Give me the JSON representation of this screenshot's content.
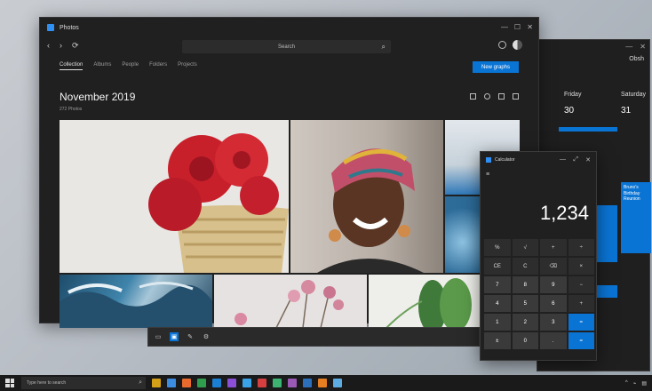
{
  "calendar": {
    "month": "Obsh",
    "days": [
      "Friday",
      "Saturday"
    ],
    "dates": [
      "30",
      "31"
    ],
    "event": "Bruno's Birthday Reunion"
  },
  "photos": {
    "title": "Photos",
    "search_placeholder": "Search",
    "tabs": [
      "Collection",
      "Albums",
      "People",
      "Folders",
      "Projects"
    ],
    "import_label": "New graphs",
    "heading": "November 2019",
    "subheading": "272 Photos"
  },
  "calculator": {
    "title": "Calculator",
    "display": "1,234",
    "keys": [
      "%",
      "√",
      "+",
      "÷",
      "CE",
      "C",
      "⌫",
      "×",
      "7",
      "8",
      "9",
      "−",
      "4",
      "5",
      "6",
      "+",
      "1",
      "2",
      "3",
      "=",
      "±",
      "0",
      ".",
      "="
    ]
  },
  "taskbar": {
    "search_placeholder": "Type here to search",
    "app_colors": [
      "#d4a017",
      "#3c8ce0",
      "#ea6a2e",
      "#2f9d4d",
      "#1b7fd3",
      "#8a4fd6",
      "#3aa3e8",
      "#d63f3f",
      "#3cb371",
      "#9b59b6",
      "#2c6fbb",
      "#e67e22",
      "#5dade2"
    ]
  },
  "colors": {
    "accent": "#0a74d4",
    "window_bg": "#202020"
  }
}
